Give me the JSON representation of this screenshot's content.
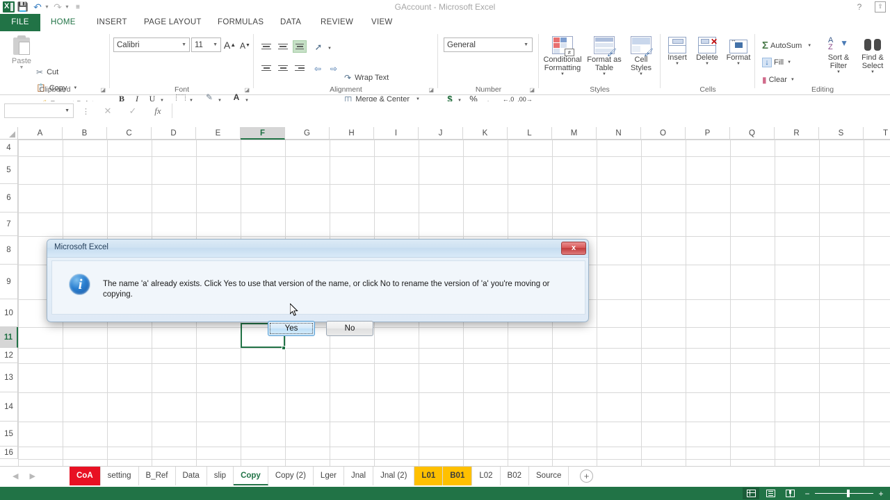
{
  "window": {
    "title": "GAccount - Microsoft Excel",
    "help_icon": "question-mark-icon",
    "ribbon_options_icon": "ribbon-display-options-icon"
  },
  "quick_access": {
    "logo": "excel-logo-icon",
    "save_icon": "save-icon",
    "undo_icon": "undo-icon",
    "redo_icon": "redo-icon",
    "customize_icon": "customize-qat-icon"
  },
  "ribbon_tabs": [
    {
      "label": "FILE",
      "active": false,
      "file": true
    },
    {
      "label": "HOME",
      "active": true,
      "file": false
    },
    {
      "label": "INSERT",
      "active": false,
      "file": false
    },
    {
      "label": "PAGE LAYOUT",
      "active": false,
      "file": false
    },
    {
      "label": "FORMULAS",
      "active": false,
      "file": false
    },
    {
      "label": "DATA",
      "active": false,
      "file": false
    },
    {
      "label": "REVIEW",
      "active": false,
      "file": false
    },
    {
      "label": "VIEW",
      "active": false,
      "file": false
    }
  ],
  "ribbon": {
    "clipboard": {
      "group_label": "Clipboard",
      "paste_label": "Paste",
      "cut_label": "Cut",
      "copy_label": "Copy",
      "format_painter_label": "Format Painter"
    },
    "font": {
      "group_label": "Font",
      "font_name": "Calibri",
      "font_size": "11",
      "grow_font": "A",
      "shrink_font": "A",
      "bold": "B",
      "italic": "I",
      "underline": "U",
      "borders_icon": "borders-icon",
      "fill_color_icon": "fill-color-icon",
      "font_color_letter": "A"
    },
    "alignment": {
      "group_label": "Alignment",
      "wrap_text_label": "Wrap Text",
      "merge_center_label": "Merge & Center",
      "orientation_icon": "orientation-icon",
      "decrease_indent_icon": "decrease-indent-icon",
      "increase_indent_icon": "increase-indent-icon"
    },
    "number": {
      "group_label": "Number",
      "format": "General",
      "currency": "$",
      "percent": "%",
      "comma": ",",
      "increase_decimal_icon": "increase-decimal-icon",
      "decrease_decimal_icon": "decrease-decimal-icon"
    },
    "styles": {
      "group_label": "Styles",
      "conditional_formatting": "Conditional Formatting",
      "format_as_table": "Format as Table",
      "cell_styles": "Cell Styles"
    },
    "cells": {
      "group_label": "Cells",
      "insert": "Insert",
      "delete": "Delete",
      "format": "Format"
    },
    "editing": {
      "group_label": "Editing",
      "autosum": "AutoSum",
      "fill": "Fill",
      "clear": "Clear",
      "sort_filter": "Sort & Filter",
      "find_select": "Find & Select"
    }
  },
  "formula_bar": {
    "name_box_value": "",
    "cancel_icon": "cancel-icon",
    "enter_icon": "enter-icon",
    "function_icon": "insert-function-icon",
    "formula_value": ""
  },
  "grid": {
    "columns": [
      "A",
      "B",
      "C",
      "D",
      "E",
      "F",
      "G",
      "H",
      "I",
      "J",
      "K",
      "L",
      "M",
      "N",
      "O",
      "P",
      "Q",
      "R",
      "S",
      "T"
    ],
    "selected_column": "F",
    "rows": [
      "4",
      "5",
      "6",
      "7",
      "8",
      "9",
      "10",
      "11",
      "12",
      "13",
      "14",
      "15",
      "16"
    ],
    "selected_row": "11",
    "active_cell": "F11"
  },
  "sheet_tabs": {
    "nav_prev_icon": "nav-prev-icon",
    "nav_next_icon": "nav-next-icon",
    "add_sheet_icon": "add-sheet-icon",
    "items": [
      {
        "label": "CoA",
        "active": false,
        "color": "#e81123",
        "text_color": "#ffffff"
      },
      {
        "label": "setting",
        "active": false,
        "color": "",
        "text_color": ""
      },
      {
        "label": "B_Ref",
        "active": false,
        "color": "",
        "text_color": ""
      },
      {
        "label": "Data",
        "active": false,
        "color": "",
        "text_color": ""
      },
      {
        "label": "slip",
        "active": false,
        "color": "",
        "text_color": ""
      },
      {
        "label": "Copy",
        "active": true,
        "color": "",
        "text_color": ""
      },
      {
        "label": "Copy (2)",
        "active": false,
        "color": "",
        "text_color": ""
      },
      {
        "label": "Lger",
        "active": false,
        "color": "",
        "text_color": ""
      },
      {
        "label": "Jnal",
        "active": false,
        "color": "",
        "text_color": ""
      },
      {
        "label": "Jnal (2)",
        "active": false,
        "color": "",
        "text_color": ""
      },
      {
        "label": "L01",
        "active": false,
        "color": "#ffc000",
        "text_color": "#3b3b3b"
      },
      {
        "label": "B01",
        "active": false,
        "color": "#ffc000",
        "text_color": "#3b3b3b"
      },
      {
        "label": "L02",
        "active": false,
        "color": "",
        "text_color": ""
      },
      {
        "label": "B02",
        "active": false,
        "color": "",
        "text_color": ""
      },
      {
        "label": "Source",
        "active": false,
        "color": "",
        "text_color": ""
      }
    ]
  },
  "status_bar": {
    "normal_view_icon": "normal-view-icon",
    "page_layout_icon": "page-layout-view-icon",
    "page_break_icon": "page-break-preview-icon",
    "zoom_out": "−",
    "zoom_in": "+"
  },
  "dialog": {
    "title": "Microsoft Excel",
    "close_label": "x",
    "icon": "information-icon",
    "message": "The name 'a' already exists. Click Yes to use that version of the name, or click No to rename the version of 'a' you're moving or copying.",
    "yes_button": "Yes",
    "no_button": "No"
  }
}
